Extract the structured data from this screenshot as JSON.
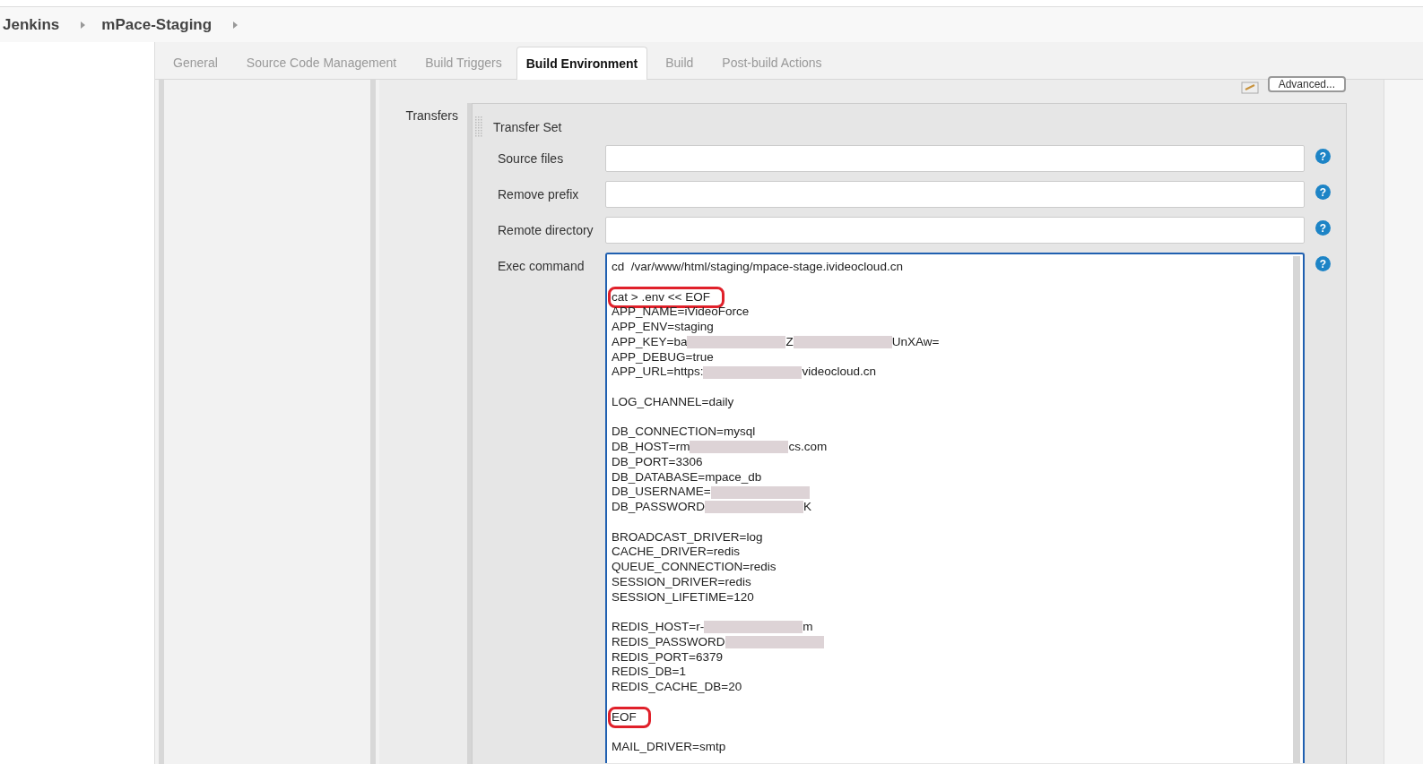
{
  "breadcrumbs": [
    "Jenkins",
    "mPace-Staging"
  ],
  "tabs": [
    {
      "label": "General",
      "selected": false
    },
    {
      "label": "Source Code Management",
      "selected": false
    },
    {
      "label": "Build Triggers",
      "selected": false
    },
    {
      "label": "Build Environment",
      "selected": true
    },
    {
      "label": "Build",
      "selected": false
    },
    {
      "label": "Post-build Actions",
      "selected": false
    }
  ],
  "advanced_button": "Advanced...",
  "section_label": "Transfers",
  "transfer_set": {
    "title": "Transfer Set",
    "fields": [
      {
        "label": "Source files",
        "help": "?"
      },
      {
        "label": "Remove prefix",
        "help": "?"
      },
      {
        "label": "Remote directory",
        "help": "?"
      }
    ],
    "exec_command": {
      "label": "Exec command",
      "help": "?",
      "lines": [
        {
          "kind": "code",
          "highlighted": false,
          "parts": [
            {
              "kind": "text",
              "text": "cd  /var/www/html/staging/mpace-stage.ivideocloud.cn"
            }
          ]
        },
        {
          "kind": "blank"
        },
        {
          "kind": "code",
          "highlighted": true,
          "parts": [
            {
              "kind": "text",
              "text": "cat > .env << EOF"
            }
          ]
        },
        {
          "kind": "code",
          "highlighted": false,
          "parts": [
            {
              "kind": "text",
              "text": "APP_NAME=iVideoForce"
            }
          ]
        },
        {
          "kind": "code",
          "highlighted": false,
          "parts": [
            {
              "kind": "text",
              "text": "APP_ENV=staging"
            }
          ]
        },
        {
          "kind": "code",
          "highlighted": false,
          "parts": [
            {
              "kind": "text",
              "text": "APP_KEY=ba"
            },
            {
              "kind": "blur"
            },
            {
              "kind": "text",
              "text": "Z"
            },
            {
              "kind": "blur"
            },
            {
              "kind": "text",
              "text": "UnXAw="
            }
          ]
        },
        {
          "kind": "code",
          "highlighted": false,
          "parts": [
            {
              "kind": "text",
              "text": "APP_DEBUG=true"
            }
          ]
        },
        {
          "kind": "code",
          "highlighted": false,
          "parts": [
            {
              "kind": "text",
              "text": "APP_URL=https:"
            },
            {
              "kind": "blur"
            },
            {
              "kind": "text",
              "text": "videocloud.cn"
            }
          ]
        },
        {
          "kind": "blank"
        },
        {
          "kind": "code",
          "highlighted": false,
          "parts": [
            {
              "kind": "text",
              "text": "LOG_CHANNEL=daily"
            }
          ]
        },
        {
          "kind": "blank"
        },
        {
          "kind": "code",
          "highlighted": false,
          "parts": [
            {
              "kind": "text",
              "text": "DB_CONNECTION=mysql"
            }
          ]
        },
        {
          "kind": "code",
          "highlighted": false,
          "parts": [
            {
              "kind": "text",
              "text": "DB_HOST=rm"
            },
            {
              "kind": "blur"
            },
            {
              "kind": "text",
              "text": "cs.com"
            }
          ]
        },
        {
          "kind": "code",
          "highlighted": false,
          "parts": [
            {
              "kind": "text",
              "text": "DB_PORT=3306"
            }
          ]
        },
        {
          "kind": "code",
          "highlighted": false,
          "parts": [
            {
              "kind": "text",
              "text": "DB_DATABASE=mpace_db"
            }
          ]
        },
        {
          "kind": "code",
          "highlighted": false,
          "parts": [
            {
              "kind": "text",
              "text": "DB_USERNAME="
            },
            {
              "kind": "blur"
            }
          ]
        },
        {
          "kind": "code",
          "highlighted": false,
          "parts": [
            {
              "kind": "text",
              "text": "DB_PASSWORD"
            },
            {
              "kind": "blur"
            },
            {
              "kind": "text",
              "text": "K"
            }
          ]
        },
        {
          "kind": "blank"
        },
        {
          "kind": "code",
          "highlighted": false,
          "parts": [
            {
              "kind": "text",
              "text": "BROADCAST_DRIVER=log"
            }
          ]
        },
        {
          "kind": "code",
          "highlighted": false,
          "parts": [
            {
              "kind": "text",
              "text": "CACHE_DRIVER=redis"
            }
          ]
        },
        {
          "kind": "code",
          "highlighted": false,
          "parts": [
            {
              "kind": "text",
              "text": "QUEUE_CONNECTION=redis"
            }
          ]
        },
        {
          "kind": "code",
          "highlighted": false,
          "parts": [
            {
              "kind": "text",
              "text": "SESSION_DRIVER=redis"
            }
          ]
        },
        {
          "kind": "code",
          "highlighted": false,
          "parts": [
            {
              "kind": "text",
              "text": "SESSION_LIFETIME=120"
            }
          ]
        },
        {
          "kind": "blank"
        },
        {
          "kind": "code",
          "highlighted": false,
          "parts": [
            {
              "kind": "text",
              "text": "REDIS_HOST=r-"
            },
            {
              "kind": "blur"
            },
            {
              "kind": "text",
              "text": "m"
            }
          ]
        },
        {
          "kind": "code",
          "highlighted": false,
          "parts": [
            {
              "kind": "text",
              "text": "REDIS_PASSWORD"
            },
            {
              "kind": "blur"
            }
          ]
        },
        {
          "kind": "code",
          "highlighted": false,
          "parts": [
            {
              "kind": "text",
              "text": "REDIS_PORT=6379"
            }
          ]
        },
        {
          "kind": "code",
          "highlighted": false,
          "parts": [
            {
              "kind": "text",
              "text": "REDIS_DB=1"
            }
          ]
        },
        {
          "kind": "code",
          "highlighted": false,
          "parts": [
            {
              "kind": "text",
              "text": "REDIS_CACHE_DB=20"
            }
          ]
        },
        {
          "kind": "blank"
        },
        {
          "kind": "code",
          "highlighted": true,
          "parts": [
            {
              "kind": "text",
              "text": "EOF"
            }
          ]
        },
        {
          "kind": "blank"
        },
        {
          "kind": "code",
          "highlighted": false,
          "parts": [
            {
              "kind": "text",
              "text": "MAIL_DRIVER=smtp"
            }
          ]
        }
      ]
    }
  }
}
